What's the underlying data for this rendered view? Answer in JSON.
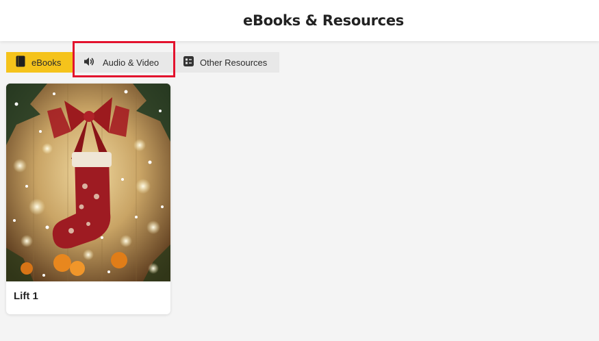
{
  "header": {
    "title": "eBooks & Resources"
  },
  "tabs": [
    {
      "label": "eBooks",
      "icon": "book-icon",
      "active": true
    },
    {
      "label": "Audio & Video",
      "icon": "speaker-icon",
      "active": false
    },
    {
      "label": "Other Resources",
      "icon": "resources-icon",
      "active": false
    }
  ],
  "cards": [
    {
      "title": "Lift 1",
      "image": "christmas-stocking-cover"
    }
  ],
  "colors": {
    "accent": "#f5c31b",
    "tab_inactive": "#e8e8e8",
    "highlight": "#e3122d",
    "background": "#f4f4f4"
  }
}
